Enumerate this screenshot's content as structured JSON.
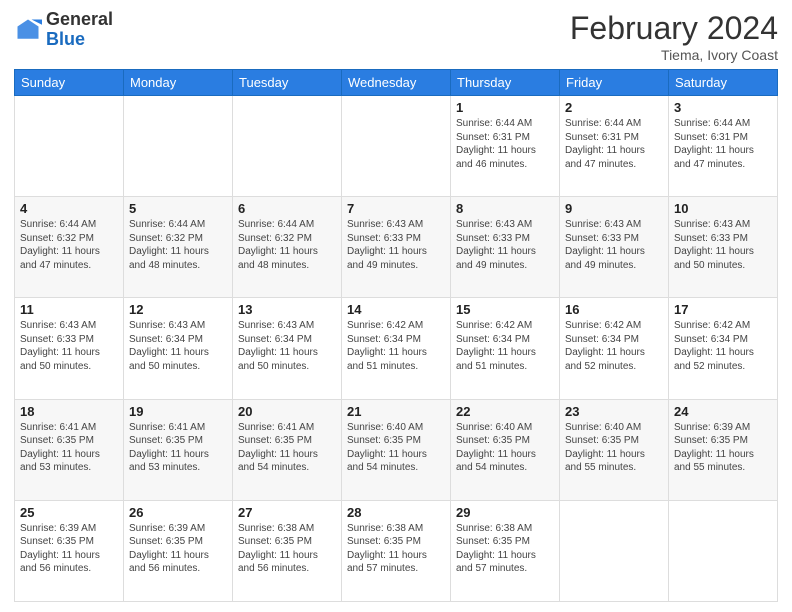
{
  "header": {
    "logo_general": "General",
    "logo_blue": "Blue",
    "title": "February 2024",
    "location": "Tiema, Ivory Coast"
  },
  "weekdays": [
    "Sunday",
    "Monday",
    "Tuesday",
    "Wednesday",
    "Thursday",
    "Friday",
    "Saturday"
  ],
  "weeks": [
    [
      {
        "day": "",
        "info": ""
      },
      {
        "day": "",
        "info": ""
      },
      {
        "day": "",
        "info": ""
      },
      {
        "day": "",
        "info": ""
      },
      {
        "day": "1",
        "info": "Sunrise: 6:44 AM\nSunset: 6:31 PM\nDaylight: 11 hours\nand 46 minutes."
      },
      {
        "day": "2",
        "info": "Sunrise: 6:44 AM\nSunset: 6:31 PM\nDaylight: 11 hours\nand 47 minutes."
      },
      {
        "day": "3",
        "info": "Sunrise: 6:44 AM\nSunset: 6:31 PM\nDaylight: 11 hours\nand 47 minutes."
      }
    ],
    [
      {
        "day": "4",
        "info": "Sunrise: 6:44 AM\nSunset: 6:32 PM\nDaylight: 11 hours\nand 47 minutes."
      },
      {
        "day": "5",
        "info": "Sunrise: 6:44 AM\nSunset: 6:32 PM\nDaylight: 11 hours\nand 48 minutes."
      },
      {
        "day": "6",
        "info": "Sunrise: 6:44 AM\nSunset: 6:32 PM\nDaylight: 11 hours\nand 48 minutes."
      },
      {
        "day": "7",
        "info": "Sunrise: 6:43 AM\nSunset: 6:33 PM\nDaylight: 11 hours\nand 49 minutes."
      },
      {
        "day": "8",
        "info": "Sunrise: 6:43 AM\nSunset: 6:33 PM\nDaylight: 11 hours\nand 49 minutes."
      },
      {
        "day": "9",
        "info": "Sunrise: 6:43 AM\nSunset: 6:33 PM\nDaylight: 11 hours\nand 49 minutes."
      },
      {
        "day": "10",
        "info": "Sunrise: 6:43 AM\nSunset: 6:33 PM\nDaylight: 11 hours\nand 50 minutes."
      }
    ],
    [
      {
        "day": "11",
        "info": "Sunrise: 6:43 AM\nSunset: 6:33 PM\nDaylight: 11 hours\nand 50 minutes."
      },
      {
        "day": "12",
        "info": "Sunrise: 6:43 AM\nSunset: 6:34 PM\nDaylight: 11 hours\nand 50 minutes."
      },
      {
        "day": "13",
        "info": "Sunrise: 6:43 AM\nSunset: 6:34 PM\nDaylight: 11 hours\nand 50 minutes."
      },
      {
        "day": "14",
        "info": "Sunrise: 6:42 AM\nSunset: 6:34 PM\nDaylight: 11 hours\nand 51 minutes."
      },
      {
        "day": "15",
        "info": "Sunrise: 6:42 AM\nSunset: 6:34 PM\nDaylight: 11 hours\nand 51 minutes."
      },
      {
        "day": "16",
        "info": "Sunrise: 6:42 AM\nSunset: 6:34 PM\nDaylight: 11 hours\nand 52 minutes."
      },
      {
        "day": "17",
        "info": "Sunrise: 6:42 AM\nSunset: 6:34 PM\nDaylight: 11 hours\nand 52 minutes."
      }
    ],
    [
      {
        "day": "18",
        "info": "Sunrise: 6:41 AM\nSunset: 6:35 PM\nDaylight: 11 hours\nand 53 minutes."
      },
      {
        "day": "19",
        "info": "Sunrise: 6:41 AM\nSunset: 6:35 PM\nDaylight: 11 hours\nand 53 minutes."
      },
      {
        "day": "20",
        "info": "Sunrise: 6:41 AM\nSunset: 6:35 PM\nDaylight: 11 hours\nand 54 minutes."
      },
      {
        "day": "21",
        "info": "Sunrise: 6:40 AM\nSunset: 6:35 PM\nDaylight: 11 hours\nand 54 minutes."
      },
      {
        "day": "22",
        "info": "Sunrise: 6:40 AM\nSunset: 6:35 PM\nDaylight: 11 hours\nand 54 minutes."
      },
      {
        "day": "23",
        "info": "Sunrise: 6:40 AM\nSunset: 6:35 PM\nDaylight: 11 hours\nand 55 minutes."
      },
      {
        "day": "24",
        "info": "Sunrise: 6:39 AM\nSunset: 6:35 PM\nDaylight: 11 hours\nand 55 minutes."
      }
    ],
    [
      {
        "day": "25",
        "info": "Sunrise: 6:39 AM\nSunset: 6:35 PM\nDaylight: 11 hours\nand 56 minutes."
      },
      {
        "day": "26",
        "info": "Sunrise: 6:39 AM\nSunset: 6:35 PM\nDaylight: 11 hours\nand 56 minutes."
      },
      {
        "day": "27",
        "info": "Sunrise: 6:38 AM\nSunset: 6:35 PM\nDaylight: 11 hours\nand 56 minutes."
      },
      {
        "day": "28",
        "info": "Sunrise: 6:38 AM\nSunset: 6:35 PM\nDaylight: 11 hours\nand 57 minutes."
      },
      {
        "day": "29",
        "info": "Sunrise: 6:38 AM\nSunset: 6:35 PM\nDaylight: 11 hours\nand 57 minutes."
      },
      {
        "day": "",
        "info": ""
      },
      {
        "day": "",
        "info": ""
      }
    ]
  ]
}
